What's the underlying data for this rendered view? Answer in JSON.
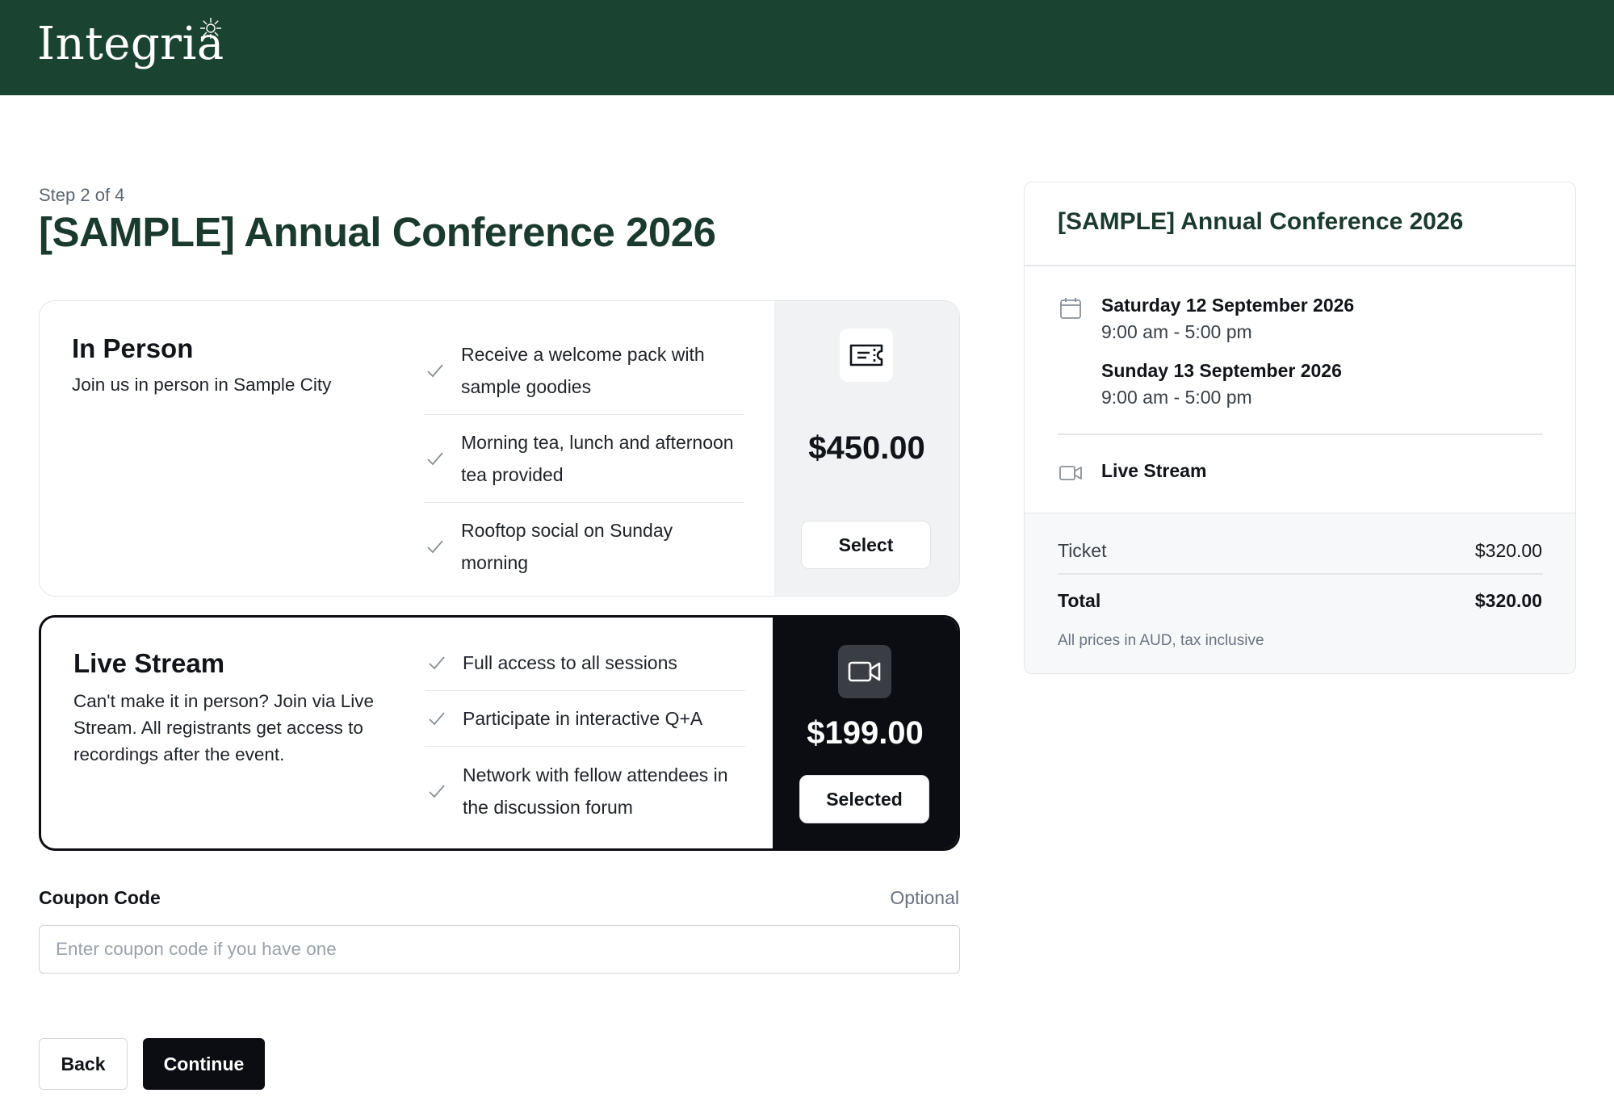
{
  "brand": {
    "name": "Integria",
    "bar_color": "#1b4332"
  },
  "step": {
    "label": "Step 2 of 4"
  },
  "event": {
    "title": "[SAMPLE] Annual Conference 2026"
  },
  "options": [
    {
      "title": "In Person",
      "description": "Join us in person in Sample City",
      "features": [
        "Receive a welcome pack with sample goodies",
        "Morning tea, lunch and afternoon tea provided",
        "Rooftop social on Sunday morning"
      ],
      "price": "$450.00",
      "button_label": "Select",
      "icon": "ticket-icon",
      "selected": false
    },
    {
      "title": "Live Stream",
      "description": "Can't make it in person? Join via Live Stream. All registrants get access to recordings after the event.",
      "features": [
        "Full access to all sessions",
        "Participate in interactive Q+A",
        "Network with fellow attendees in the discussion forum"
      ],
      "price": "$199.00",
      "button_label": "Selected",
      "icon": "video-camera-icon",
      "selected": true
    }
  ],
  "coupon": {
    "label": "Coupon Code",
    "optional_label": "Optional",
    "placeholder": "Enter coupon code if you have one",
    "value": ""
  },
  "actions": {
    "back_label": "Back",
    "continue_label": "Continue"
  },
  "summary": {
    "title": "[SAMPLE] Annual Conference 2026",
    "dates": [
      {
        "day": "Saturday 12 September 2026",
        "time": "9:00 am - 5:00 pm"
      },
      {
        "day": "Sunday 13 September 2026",
        "time": "9:00 am - 5:00 pm"
      }
    ],
    "attendance": "Live Stream",
    "ticket_label": "Ticket",
    "ticket_value": "$320.00",
    "total_label": "Total",
    "total_value": "$320.00",
    "note": "All prices in AUD, tax inclusive"
  }
}
